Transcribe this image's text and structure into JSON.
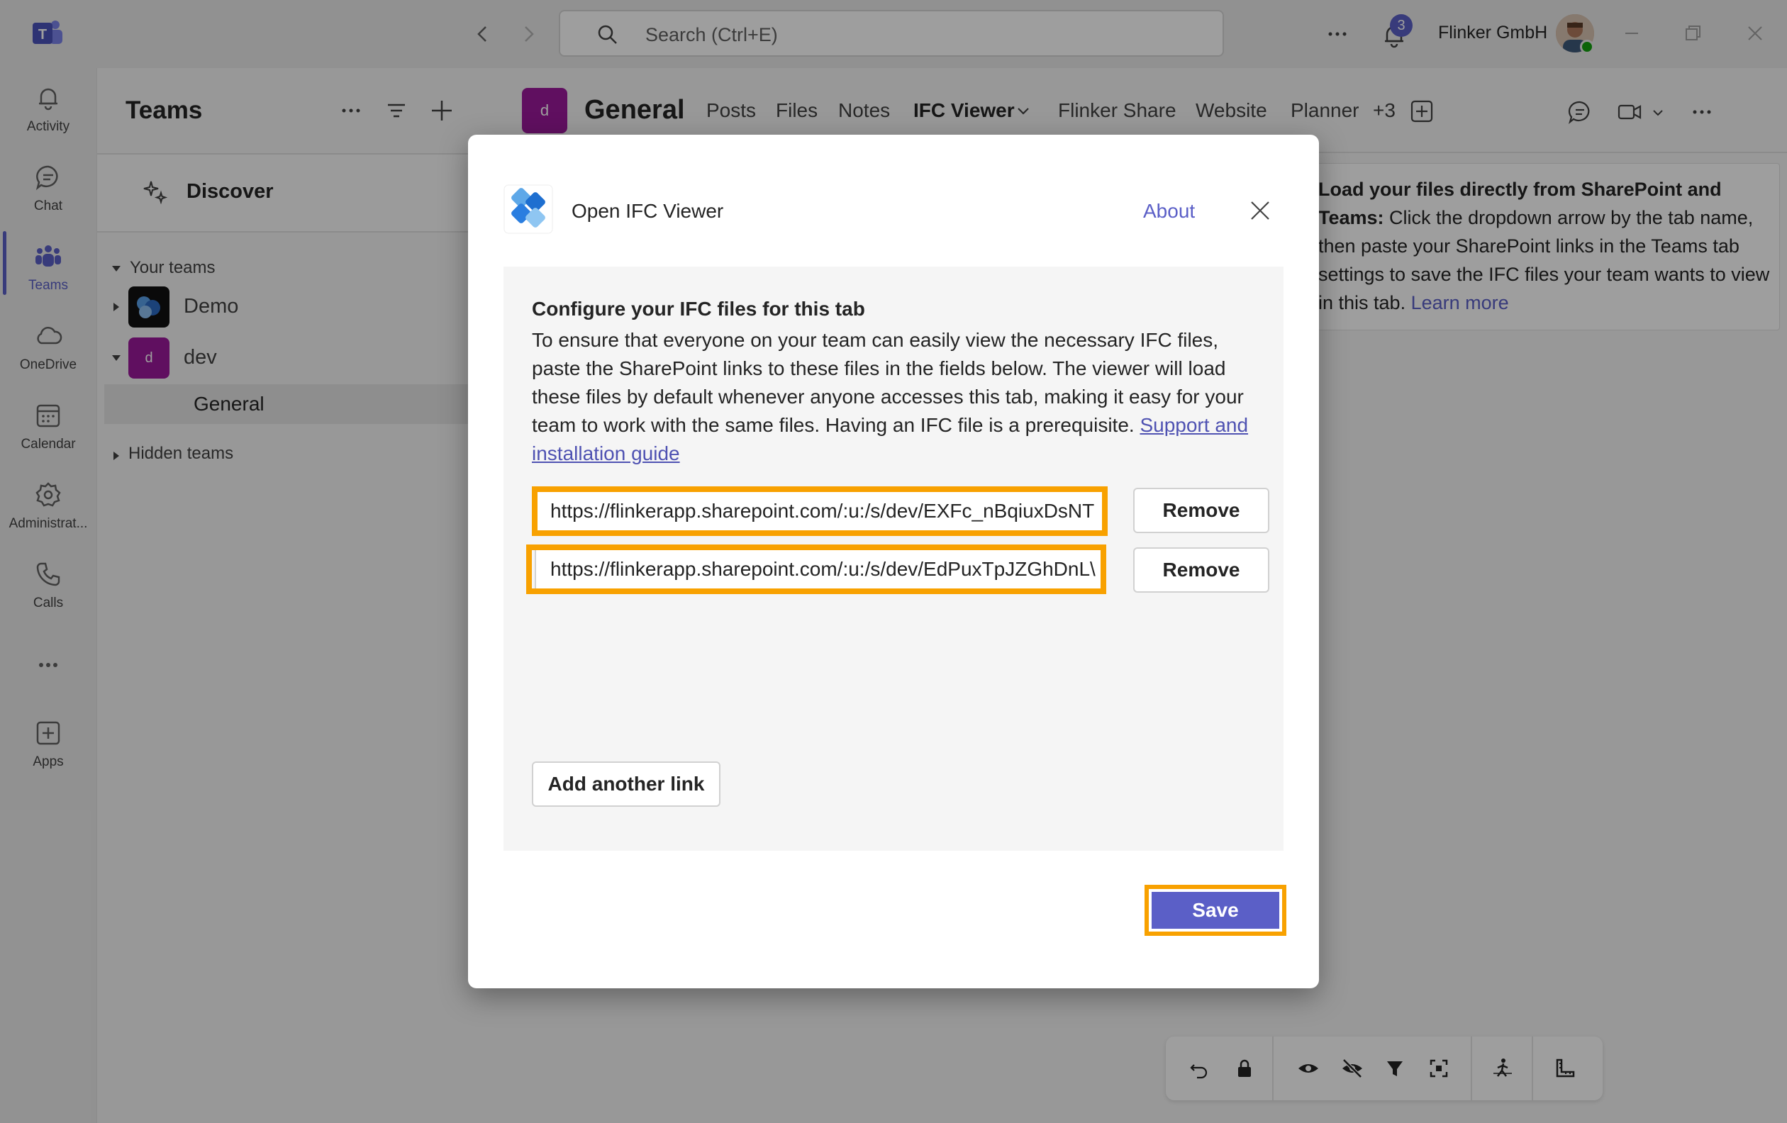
{
  "titlebar": {
    "search_placeholder": "Search (Ctrl+E)",
    "notification_count": "3",
    "org_name": "Flinker GmbH"
  },
  "rail": {
    "items": [
      {
        "label": "Activity",
        "icon": "bell-icon"
      },
      {
        "label": "Chat",
        "icon": "chat-icon"
      },
      {
        "label": "Teams",
        "icon": "teams-icon"
      },
      {
        "label": "OneDrive",
        "icon": "cloud-icon"
      },
      {
        "label": "Calendar",
        "icon": "calendar-icon"
      },
      {
        "label": "Administrat...",
        "icon": "admin-icon"
      },
      {
        "label": "Calls",
        "icon": "phone-icon"
      },
      {
        "label": "Apps",
        "icon": "apps-icon"
      }
    ]
  },
  "teams_panel": {
    "title": "Teams",
    "discover_label": "Discover",
    "your_teams_label": "Your teams",
    "teams": [
      {
        "name": "Demo"
      },
      {
        "name": "dev",
        "avatar_letter": "d"
      }
    ],
    "channel": "General",
    "hidden_teams_label": "Hidden teams"
  },
  "channel_header": {
    "avatar_letter": "d",
    "name": "General",
    "tabs": [
      "Posts",
      "Files",
      "Notes",
      "IFC Viewer",
      "Flinker Share",
      "Website",
      "Planner",
      "+3"
    ]
  },
  "info_box": {
    "bold": "Load your files directly from SharePoint and Teams:",
    "text": " Click the dropdown arrow by the tab name, then paste your SharePoint links in the Teams tab settings to save the IFC files your team wants to view in this tab. ",
    "link": "Learn more"
  },
  "dialog": {
    "title": "Open IFC Viewer",
    "about_label": "About",
    "heading": "Configure your IFC files for this tab",
    "description": "To ensure that everyone on your team can easily view the necessary IFC files, paste the SharePoint links to these files in the fields below. The viewer will load these files by default whenever anyone accesses this tab, making it easy for your team to work with the same files. Having an IFC file is a prerequisite. ",
    "guide_link": "Support and installation guide",
    "links": [
      "https://flinkerapp.sharepoint.com/:u:/s/dev/EXFc_nBqiuxDsNT",
      "https://flinkerapp.sharepoint.com/:u:/s/dev/EdPuxTpJZGhDnL\\"
    ],
    "remove_label": "Remove",
    "add_label": "Add another link",
    "save_label": "Save"
  },
  "colors": {
    "accent": "#5b5fc7",
    "highlight": "#f8a100",
    "team_avatar": "#9b199b"
  }
}
